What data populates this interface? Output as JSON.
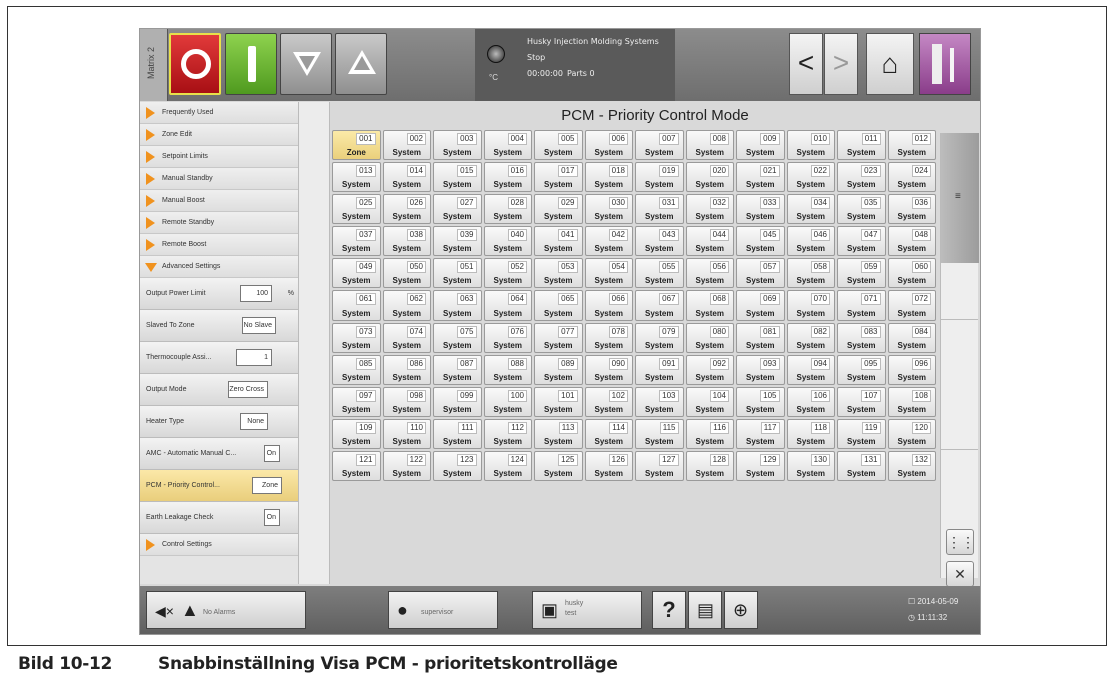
{
  "topbar": {
    "matrix_label": "Matrix 2",
    "status_title": "Husky Injection Molding Systems",
    "status_state": "Stop",
    "status_time": "00:00:00",
    "status_parts": "Parts 0",
    "temp_unit": "°C",
    "back_label": "<",
    "forward_label": ">",
    "home_icon": "⌂"
  },
  "sidebar": {
    "groups_top": [
      {
        "label": "Frequently Used"
      },
      {
        "label": "Zone Edit"
      },
      {
        "label": "Setpoint Limits"
      },
      {
        "label": "Manual Standby"
      },
      {
        "label": "Manual Boost"
      },
      {
        "label": "Remote Standby"
      },
      {
        "label": "Remote Boost"
      },
      {
        "label": "Advanced Settings"
      }
    ],
    "settings": [
      {
        "label": "Output Power Limit",
        "value": "100",
        "unit": "%"
      },
      {
        "label": "Slaved To Zone",
        "value": "No Slave",
        "unit": ""
      },
      {
        "label": "Thermocouple Assi...",
        "value": "1",
        "unit": ""
      },
      {
        "label": "Output Mode",
        "value": "Zero Cross",
        "unit": ""
      },
      {
        "label": "Heater Type",
        "value": "None",
        "unit": ""
      },
      {
        "label": "AMC - Automatic Manual C...",
        "value": "On",
        "unit": ""
      },
      {
        "label": "PCM - Priority Control...",
        "value": "Zone",
        "unit": ""
      },
      {
        "label": "Earth Leakage Check",
        "value": "On",
        "unit": ""
      }
    ],
    "groups_bottom": [
      {
        "label": "Control Settings"
      }
    ]
  },
  "main": {
    "title": "PCM - Priority Control Mode",
    "first_zone_type": "Zone",
    "default_type": "System",
    "zone_count": 132
  },
  "bottombar": {
    "alarm_text": "No Alarms",
    "user_text": "supervisor",
    "mold_name": "husky",
    "mold_sub": "test",
    "help_label": "?",
    "date": "2014-05-09",
    "time": "11:11:32"
  },
  "caption": {
    "number": "Bild 10-12",
    "text": "Snabbinställning Visa PCM - prioritetskontrolläge"
  },
  "colors": {
    "stop": "#c8141a",
    "start": "#6ab734",
    "accent_arrow": "#f0921e",
    "active_setting": "#f3dc92"
  }
}
